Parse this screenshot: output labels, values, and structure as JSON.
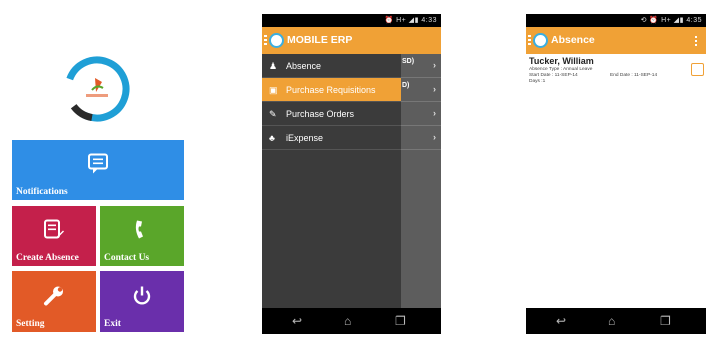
{
  "home": {
    "tiles": [
      {
        "label": "Notifications"
      },
      {
        "label": "Create Absence"
      },
      {
        "label": "Contact Us"
      },
      {
        "label": "Setting"
      },
      {
        "label": "Exit"
      }
    ]
  },
  "drawer_screen": {
    "status_time": "4:33",
    "title": "MOBILE ERP",
    "menu": [
      {
        "label": "Absence",
        "icon": "person-icon"
      },
      {
        "label": "Purchase Requisitions",
        "icon": "document-icon",
        "selected": true
      },
      {
        "label": "Purchase Orders",
        "icon": "pen-icon"
      },
      {
        "label": "iExpense",
        "icon": "expense-icon"
      }
    ],
    "background_rows": [
      "SD)",
      "D)",
      "",
      ""
    ]
  },
  "absence_screen": {
    "status_time": "4:35",
    "title": "Absence",
    "entry": {
      "name": "Tucker, William",
      "absence_type": "Absence Type : Annual Leave",
      "start_date": "Start Date : 11-SEP-14",
      "end_date": "End Date : 11-SEP-14",
      "days": "Days :1"
    }
  },
  "colors": {
    "accent_orange": "#f0a136",
    "tile_blue": "#2f8ee6",
    "tile_red": "#c4204b",
    "tile_green": "#5aa62a",
    "tile_orange": "#e25a27",
    "tile_purple": "#6a2fab"
  }
}
